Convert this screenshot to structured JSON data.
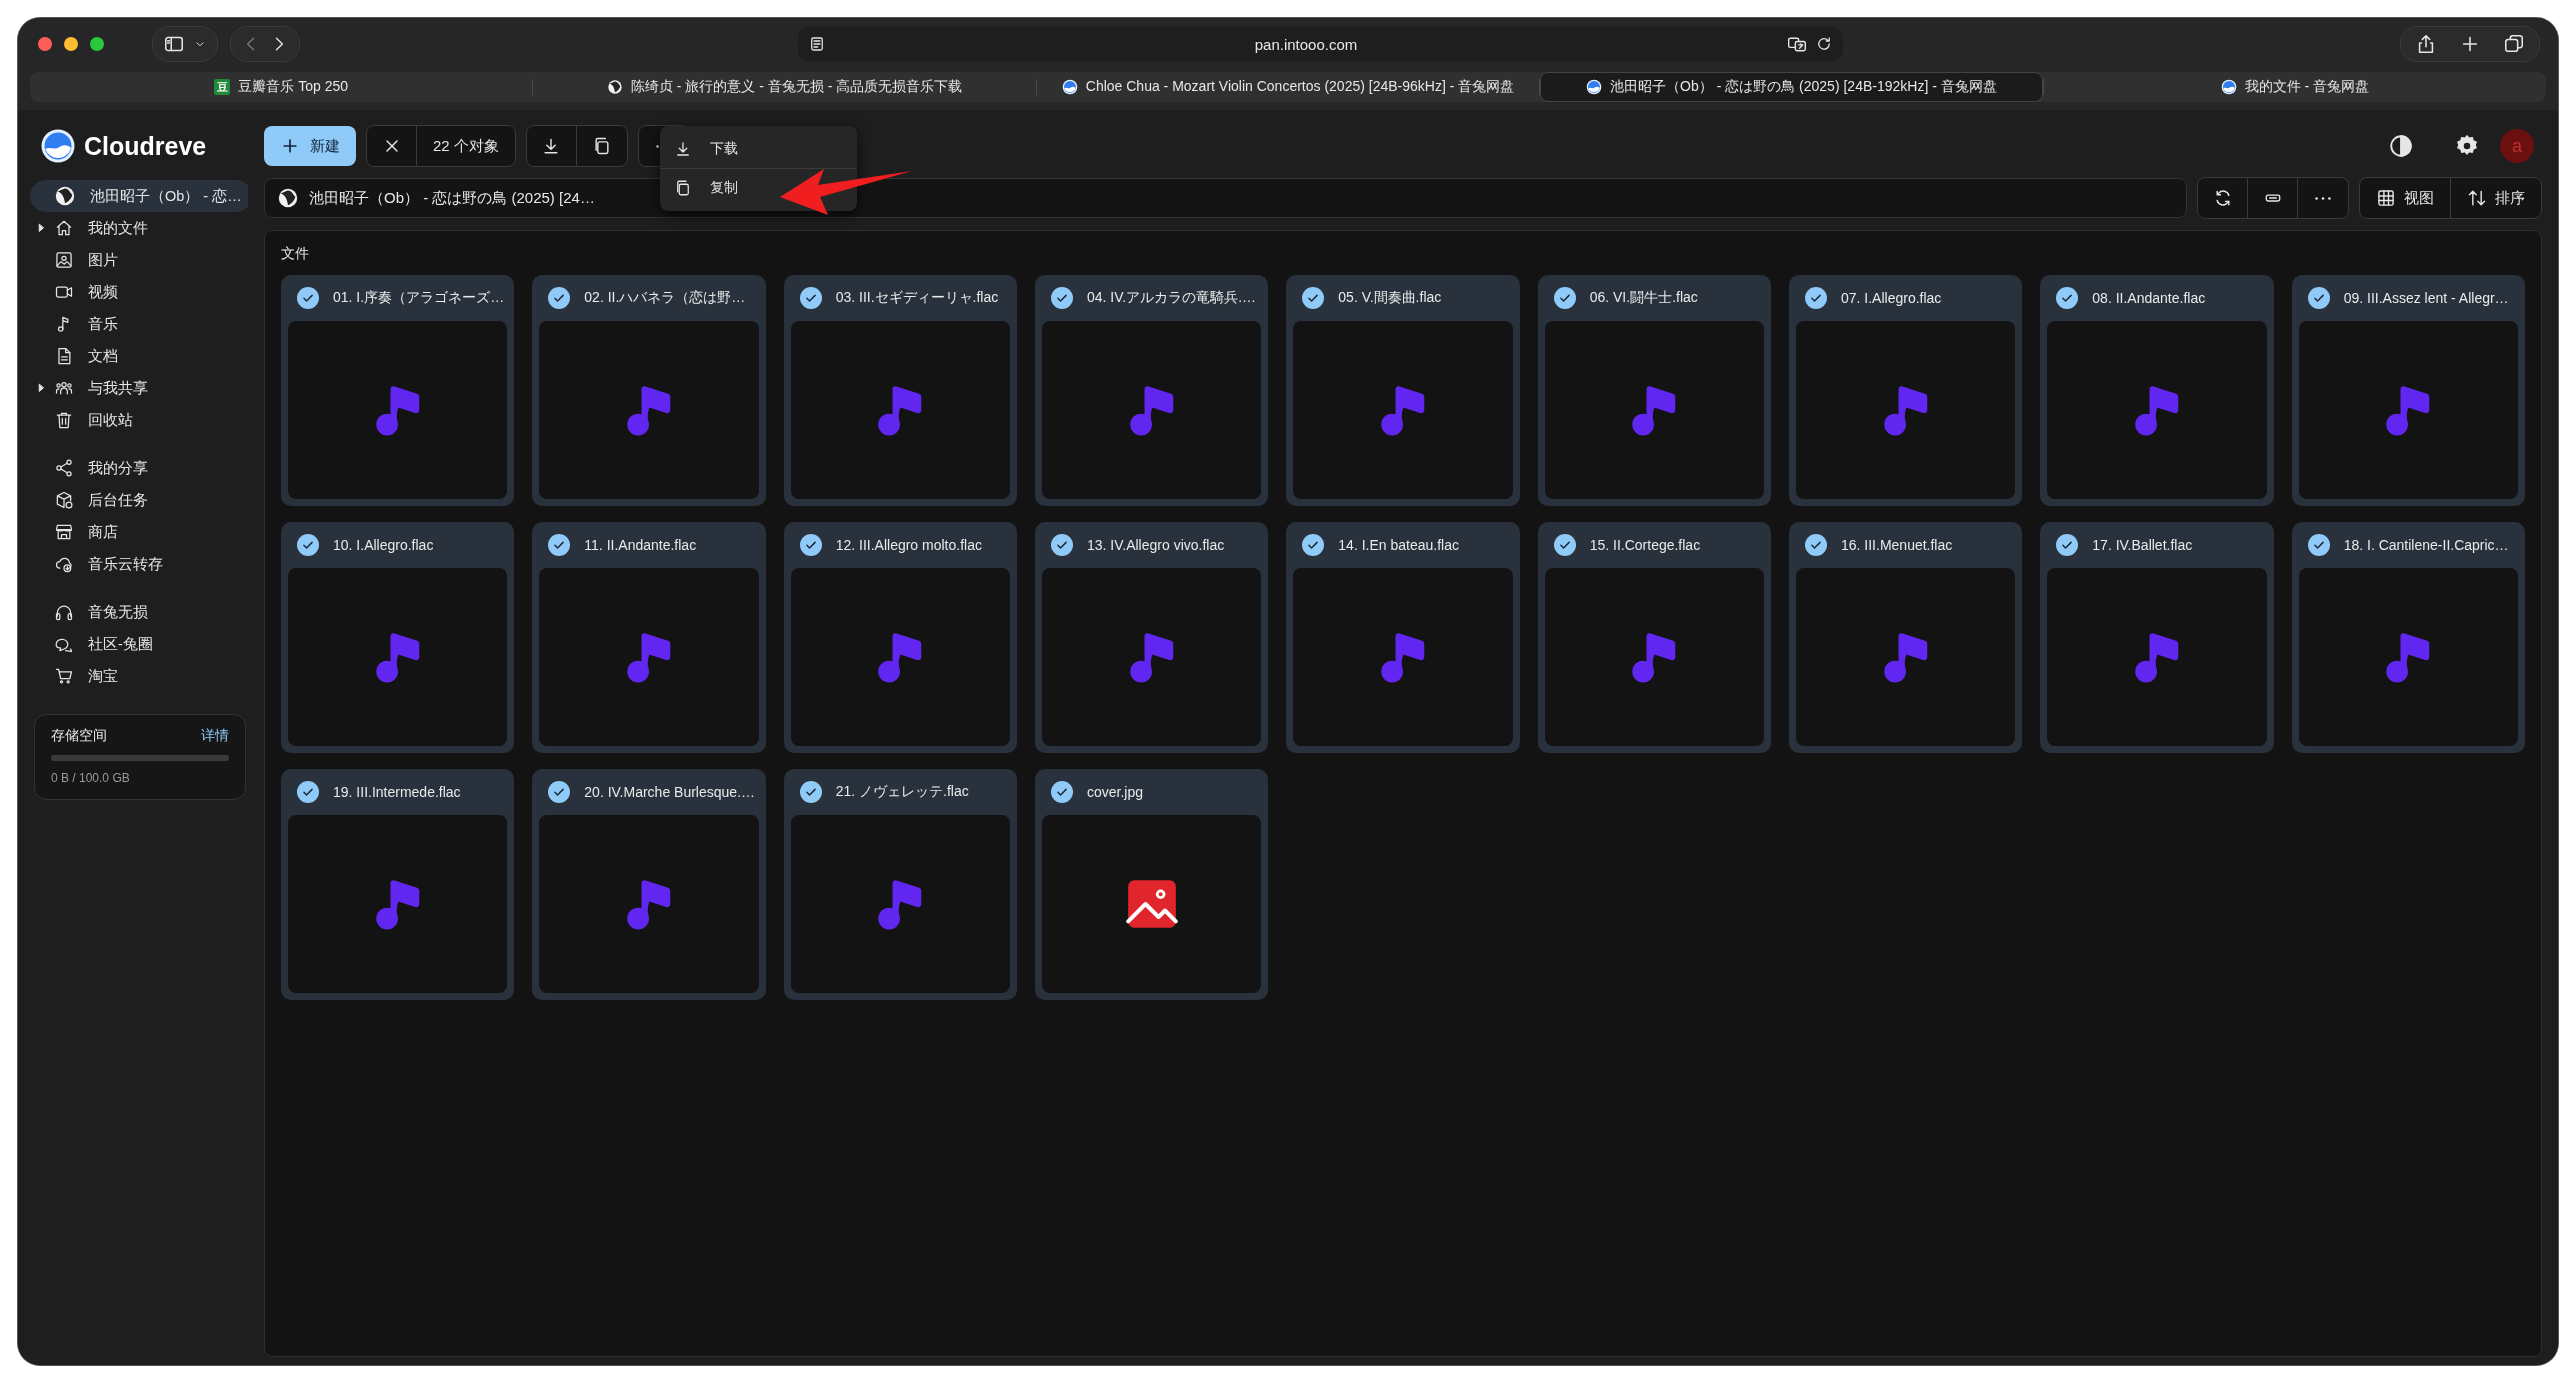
{
  "browser": {
    "address": "pan.intooo.com",
    "tabs": [
      {
        "label": "豆瓣音乐 Top 250",
        "kind": "badge",
        "icon_text": "豆",
        "selected": false
      },
      {
        "label": "陈绮贞 - 旅行的意义 - 音兔无损 - 高品质无损音乐下载",
        "kind": "photo",
        "selected": false
      },
      {
        "label": "Chloe Chua - Mozart Violin Concertos (2025) [24B-96kHz] - 音兔网盘",
        "kind": "logo",
        "selected": false
      },
      {
        "label": "池田昭子（Ob） - 恋は野の鳥 (2025) [24B-192kHz] - 音兔网盘",
        "kind": "logo",
        "selected": true
      },
      {
        "label": "我的文件 - 音兔网盘",
        "kind": "logo",
        "selected": false
      }
    ]
  },
  "app": {
    "brand": "Cloudreve",
    "avatar": "a"
  },
  "sidebar": {
    "groups": [
      {
        "items": [
          {
            "label": "池田昭子（Ob） - 恋…",
            "selected": true
          },
          {
            "label": "我的文件",
            "selected": false,
            "expanded": false
          },
          {
            "label": "图片",
            "selected": false
          },
          {
            "label": "视频",
            "selected": false
          },
          {
            "label": "音乐",
            "selected": false
          },
          {
            "label": "文档",
            "selected": false
          },
          {
            "label": "与我共享",
            "selected": false,
            "expanded": false
          },
          {
            "label": "回收站",
            "selected": false
          }
        ]
      },
      {
        "items": [
          {
            "label": "我的分享",
            "selected": false
          },
          {
            "label": "后台任务",
            "selected": false
          },
          {
            "label": "商店",
            "selected": false
          },
          {
            "label": "音乐云转存",
            "selected": false
          }
        ]
      },
      {
        "items": [
          {
            "label": "音兔无损",
            "selected": false
          },
          {
            "label": "社区-兔圈",
            "selected": false
          },
          {
            "label": "淘宝",
            "selected": false
          }
        ]
      }
    ],
    "storage": {
      "title": "存储空间",
      "link": "详情",
      "level": 0,
      "reading": "0 B / 100.0 GB"
    }
  },
  "toolbar": {
    "new": "新建",
    "selection": "22 个对象"
  },
  "menu": [
    {
      "label": "下载"
    },
    {
      "label": "复制"
    }
  ],
  "breadcrumb": "池田昭子（Ob） - 恋は野の鳥 (2025) [24…",
  "view_controls": [
    {
      "label": "视图"
    },
    {
      "label": "排序"
    }
  ],
  "section_title": "文件",
  "files": [
    {
      "name": "01. I.序奏（アラゴネーズ…",
      "kind": "audio",
      "checked": true
    },
    {
      "name": "02. II.ハバネラ（恋は野…",
      "kind": "audio",
      "checked": true
    },
    {
      "name": "03. III.セギディーリャ.flac",
      "kind": "audio",
      "checked": true
    },
    {
      "name": "04. IV.アルカラの竜騎兵.…",
      "kind": "audio",
      "checked": true
    },
    {
      "name": "05. V.間奏曲.flac",
      "kind": "audio",
      "checked": true
    },
    {
      "name": "06. VI.闘牛士.flac",
      "kind": "audio",
      "checked": true
    },
    {
      "name": "07. I.Allegro.flac",
      "kind": "audio",
      "checked": true
    },
    {
      "name": "08. II.Andante.flac",
      "kind": "audio",
      "checked": true
    },
    {
      "name": "09. III.Assez lent - Allegr…",
      "kind": "audio",
      "checked": true
    },
    {
      "name": "10. I.Allegro.flac",
      "kind": "audio",
      "checked": true
    },
    {
      "name": "11. II.Andante.flac",
      "kind": "audio",
      "checked": true
    },
    {
      "name": "12. III.Allegro molto.flac",
      "kind": "audio",
      "checked": true
    },
    {
      "name": "13. IV.Allegro vivo.flac",
      "kind": "audio",
      "checked": true
    },
    {
      "name": "14. I.En bateau.flac",
      "kind": "audio",
      "checked": true
    },
    {
      "name": "15. II.Cortege.flac",
      "kind": "audio",
      "checked": true
    },
    {
      "name": "16. III.Menuet.flac",
      "kind": "audio",
      "checked": true
    },
    {
      "name": "17. IV.Ballet.flac",
      "kind": "audio",
      "checked": true
    },
    {
      "name": "18. I. Cantilene-II.Capric…",
      "kind": "audio",
      "checked": true
    },
    {
      "name": "19. III.Intermede.flac",
      "kind": "audio",
      "checked": true
    },
    {
      "name": "20. IV.Marche Burlesque.…",
      "kind": "audio",
      "checked": true
    },
    {
      "name": "21. ノヴェレッテ.flac",
      "kind": "audio",
      "checked": true
    },
    {
      "name": "cover.jpg",
      "kind": "image",
      "checked": true
    }
  ]
}
